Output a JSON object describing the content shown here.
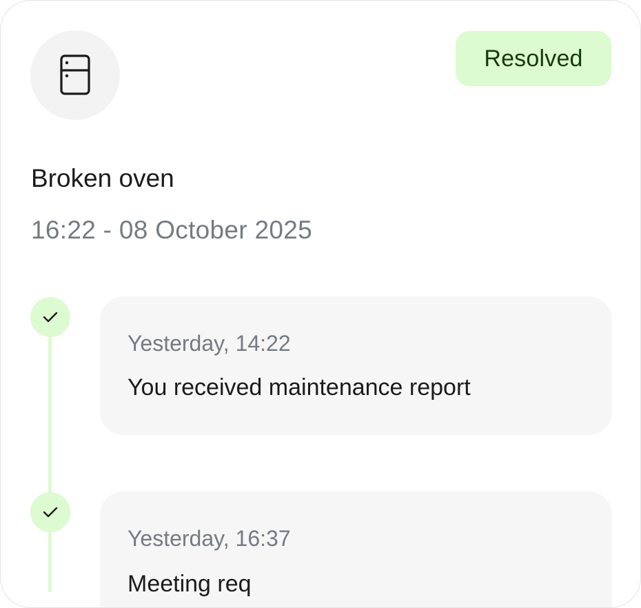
{
  "request": {
    "icon": "fridge-icon",
    "status": "Resolved",
    "title": "Broken oven",
    "timestamp": "16:22 - 08 October 2025"
  },
  "timeline": {
    "events": [
      {
        "time": "Yesterday, 14:22",
        "text": "You received maintenance report",
        "icon": "check-icon"
      },
      {
        "time": "Yesterday, 16:37",
        "text": "Meeting req",
        "icon": "check-icon"
      }
    ]
  },
  "colors": {
    "status_bg": "#dcfbd0",
    "status_text": "#163a0f",
    "muted_text": "#757a82",
    "card_bg": "#f6f6f6"
  }
}
